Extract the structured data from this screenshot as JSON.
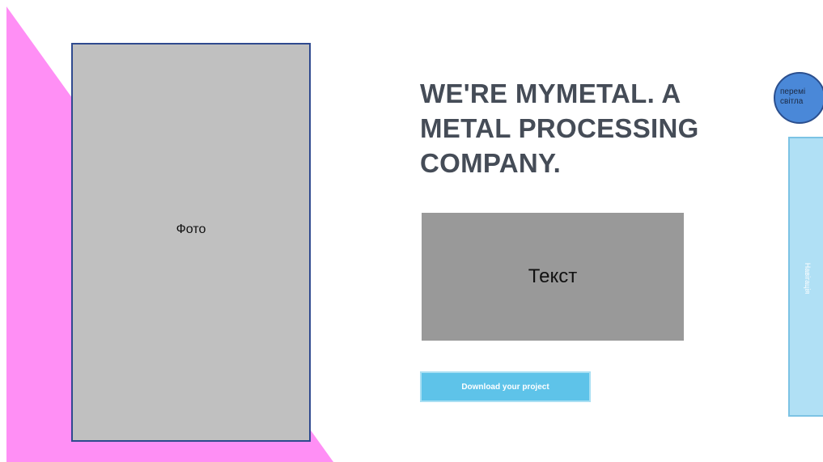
{
  "hero": {
    "photo_label": "Фото",
    "headline_line1": "WE'RE MYMETAL. A",
    "headline_line2": "METAL PROCESSING",
    "headline_line3": "COMPANY.",
    "text_placeholder": "Текст",
    "download_label": "Download your project"
  },
  "theme_toggle": {
    "line1": "перемі",
    "line2": "світла"
  },
  "nav": {
    "label": "Навігація"
  },
  "colors": {
    "pink_accent": "#ff8ff5",
    "photo_fill": "#c0c0c0",
    "photo_border": "#2f4a8f",
    "headline": "#454c57",
    "text_box": "#999999",
    "button": "#5ec3e9",
    "toggle": "#4a88d8",
    "nav_panel": "#b0e0f5"
  }
}
